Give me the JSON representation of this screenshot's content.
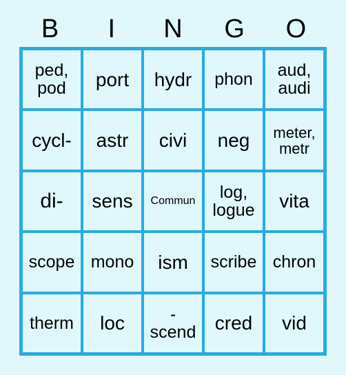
{
  "colors": {
    "page_background": "#e0f8fc",
    "grid_line": "#29abe2",
    "cell_background": "#e0f8fc",
    "text": "#000000"
  },
  "header": {
    "letters": [
      "B",
      "I",
      "N",
      "G",
      "O"
    ]
  },
  "grid": {
    "rows": [
      [
        {
          "text": "ped,\npod",
          "size": "s-md"
        },
        {
          "text": "port",
          "size": "s-lg"
        },
        {
          "text": "hydr",
          "size": "s-lg"
        },
        {
          "text": "phon",
          "size": "s-md"
        },
        {
          "text": "aud,\naudi",
          "size": "s-md"
        }
      ],
      [
        {
          "text": "cycl-",
          "size": "s-lg"
        },
        {
          "text": "astr",
          "size": "s-lg"
        },
        {
          "text": "civi",
          "size": "s-lg"
        },
        {
          "text": "neg",
          "size": "s-lg"
        },
        {
          "text": "meter,\nmetr",
          "size": "s-sm"
        }
      ],
      [
        {
          "text": "di-",
          "size": "s-xl"
        },
        {
          "text": "sens",
          "size": "s-lg"
        },
        {
          "text": "Commun",
          "size": "s-xs"
        },
        {
          "text": "log,\nlogue",
          "size": "s-md"
        },
        {
          "text": "vita",
          "size": "s-lg"
        }
      ],
      [
        {
          "text": "scope",
          "size": "s-md"
        },
        {
          "text": "mono",
          "size": "s-md"
        },
        {
          "text": "ism",
          "size": "s-lg"
        },
        {
          "text": "scribe",
          "size": "s-md"
        },
        {
          "text": "chron",
          "size": "s-md"
        }
      ],
      [
        {
          "text": "therm",
          "size": "s-md"
        },
        {
          "text": "loc",
          "size": "s-lg"
        },
        {
          "text": "-\nscend",
          "size": "s-md"
        },
        {
          "text": "cred",
          "size": "s-lg"
        },
        {
          "text": "vid",
          "size": "s-lg"
        }
      ]
    ]
  }
}
